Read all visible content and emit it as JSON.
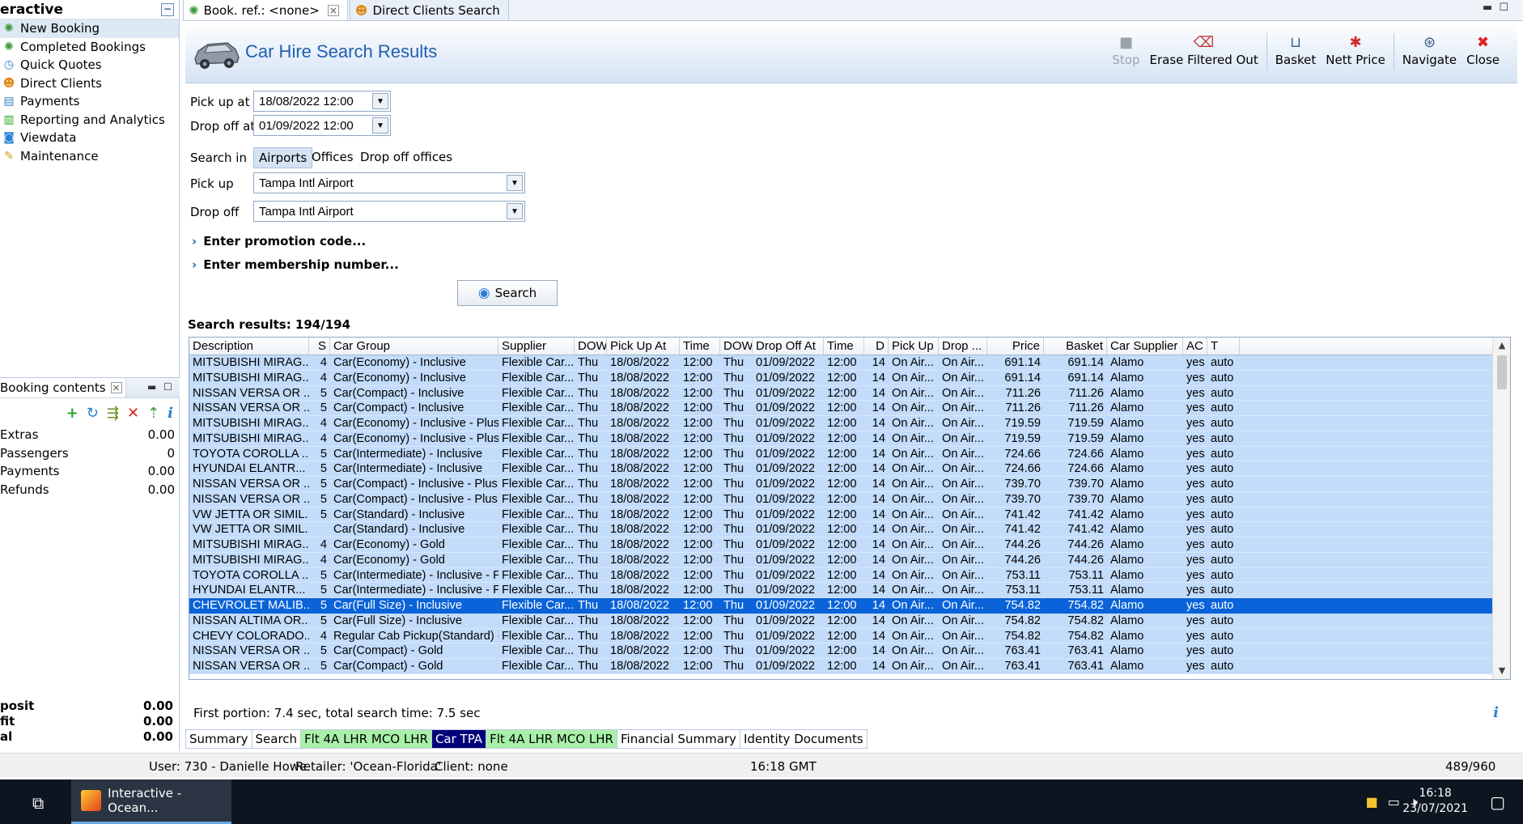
{
  "nav": {
    "title": "eractive",
    "items": [
      {
        "label": "New Booking",
        "icon": "palm-tree-icon",
        "selected": true
      },
      {
        "label": "Completed Bookings",
        "icon": "palm-tree-icon"
      },
      {
        "label": "Quick Quotes",
        "icon": "clock-icon"
      },
      {
        "label": "Direct Clients",
        "icon": "person-icon"
      },
      {
        "label": "Payments",
        "icon": "card-icon"
      },
      {
        "label": "Reporting and Analytics",
        "icon": "chart-icon"
      },
      {
        "label": "Viewdata",
        "icon": "monitor-icon"
      },
      {
        "label": "Maintenance",
        "icon": "tools-icon"
      }
    ]
  },
  "booking": {
    "title": "Booking contents",
    "rows": [
      {
        "label": "Extras",
        "value": "0.00"
      },
      {
        "label": "Passengers",
        "value": "0"
      },
      {
        "label": "Payments",
        "value": "0.00"
      },
      {
        "label": "Refunds",
        "value": "0.00"
      }
    ],
    "totals": [
      {
        "label": "posit",
        "value": "0.00"
      },
      {
        "label": "fit",
        "value": "0.00"
      },
      {
        "label": "al",
        "value": "0.00"
      }
    ]
  },
  "doc_tabs": [
    {
      "label": "Book. ref.: <none>",
      "closable": true,
      "active": true
    },
    {
      "label": "Direct Clients Search",
      "closable": false,
      "active": false
    }
  ],
  "header": {
    "title": "Car Hire Search Results",
    "toolbar": [
      {
        "label": "Stop",
        "icon": "stop-icon",
        "disabled": true
      },
      {
        "label": "Erase Filtered Out",
        "icon": "erase-icon"
      },
      {
        "sep": true
      },
      {
        "label": "Basket",
        "icon": "basket-icon"
      },
      {
        "label": "Nett Price",
        "icon": "nett-price-icon"
      },
      {
        "sep": true
      },
      {
        "label": "Navigate",
        "icon": "navigate-icon"
      },
      {
        "label": "Close",
        "icon": "close-icon"
      }
    ]
  },
  "form": {
    "pickup_at_label": "Pick up at",
    "pickup_at_value": "18/08/2022 12:00",
    "dropoff_at_label": "Drop off at",
    "dropoff_at_value": "01/09/2022 12:00",
    "search_in_label": "Search in",
    "search_in_options": [
      "Airports",
      "Offices",
      "Drop off offices"
    ],
    "pickup_label": "Pick up",
    "pickup_value": "Tampa Intl Airport",
    "dropoff_label": "Drop off",
    "dropoff_value": "Tampa Intl Airport",
    "promo": "Enter promotion code...",
    "membership": "Enter membership number...",
    "search_button": "Search",
    "results_label": "Search results: 194/194"
  },
  "grid": {
    "columns": [
      "Description",
      "S",
      "Car Group",
      "Supplier",
      "DOW",
      "Pick Up At",
      "Time",
      "DOW",
      "Drop Off At",
      "Time",
      "D",
      "Pick Up",
      "Drop ...",
      "Price",
      "Basket",
      "Car Supplier",
      "AC",
      "T"
    ],
    "rows": [
      [
        "MITSUBISHI MIRAG...",
        "4",
        "Car(Economy) - Inclusive",
        "Flexible Car...",
        "Thu",
        "18/08/2022",
        "12:00",
        "Thu",
        "01/09/2022",
        "12:00",
        "14",
        "On Air...",
        "On Air...",
        "691.14",
        "691.14",
        "Alamo",
        "yes",
        "auto"
      ],
      [
        "MITSUBISHI MIRAG...",
        "4",
        "Car(Economy) - Inclusive",
        "Flexible Car...",
        "Thu",
        "18/08/2022",
        "12:00",
        "Thu",
        "01/09/2022",
        "12:00",
        "14",
        "On Air...",
        "On Air...",
        "691.14",
        "691.14",
        "Alamo",
        "yes",
        "auto"
      ],
      [
        "NISSAN VERSA OR ...",
        "5",
        "Car(Compact) - Inclusive",
        "Flexible Car...",
        "Thu",
        "18/08/2022",
        "12:00",
        "Thu",
        "01/09/2022",
        "12:00",
        "14",
        "On Air...",
        "On Air...",
        "711.26",
        "711.26",
        "Alamo",
        "yes",
        "auto"
      ],
      [
        "NISSAN VERSA OR ...",
        "5",
        "Car(Compact) - Inclusive",
        "Flexible Car...",
        "Thu",
        "18/08/2022",
        "12:00",
        "Thu",
        "01/09/2022",
        "12:00",
        "14",
        "On Air...",
        "On Air...",
        "711.26",
        "711.26",
        "Alamo",
        "yes",
        "auto"
      ],
      [
        "MITSUBISHI MIRAG...",
        "4",
        "Car(Economy) - Inclusive - Plus Ex...",
        "Flexible Car...",
        "Thu",
        "18/08/2022",
        "12:00",
        "Thu",
        "01/09/2022",
        "12:00",
        "14",
        "On Air...",
        "On Air...",
        "719.59",
        "719.59",
        "Alamo",
        "yes",
        "auto"
      ],
      [
        "MITSUBISHI MIRAG...",
        "4",
        "Car(Economy) - Inclusive - Plus Ex...",
        "Flexible Car...",
        "Thu",
        "18/08/2022",
        "12:00",
        "Thu",
        "01/09/2022",
        "12:00",
        "14",
        "On Air...",
        "On Air...",
        "719.59",
        "719.59",
        "Alamo",
        "yes",
        "auto"
      ],
      [
        "TOYOTA COROLLA ...",
        "5",
        "Car(Intermediate) - Inclusive",
        "Flexible Car...",
        "Thu",
        "18/08/2022",
        "12:00",
        "Thu",
        "01/09/2022",
        "12:00",
        "14",
        "On Air...",
        "On Air...",
        "724.66",
        "724.66",
        "Alamo",
        "yes",
        "auto"
      ],
      [
        "HYUNDAI ELANTR...",
        "5",
        "Car(Intermediate) - Inclusive",
        "Flexible Car...",
        "Thu",
        "18/08/2022",
        "12:00",
        "Thu",
        "01/09/2022",
        "12:00",
        "14",
        "On Air...",
        "On Air...",
        "724.66",
        "724.66",
        "Alamo",
        "yes",
        "auto"
      ],
      [
        "NISSAN VERSA OR ...",
        "5",
        "Car(Compact) - Inclusive - Plus Exc...",
        "Flexible Car...",
        "Thu",
        "18/08/2022",
        "12:00",
        "Thu",
        "01/09/2022",
        "12:00",
        "14",
        "On Air...",
        "On Air...",
        "739.70",
        "739.70",
        "Alamo",
        "yes",
        "auto"
      ],
      [
        "NISSAN VERSA OR ...",
        "5",
        "Car(Compact) - Inclusive - Plus Exc...",
        "Flexible Car...",
        "Thu",
        "18/08/2022",
        "12:00",
        "Thu",
        "01/09/2022",
        "12:00",
        "14",
        "On Air...",
        "On Air...",
        "739.70",
        "739.70",
        "Alamo",
        "yes",
        "auto"
      ],
      [
        "VW JETTA OR SIMIL...",
        "5",
        "Car(Standard) - Inclusive",
        "Flexible Car...",
        "Thu",
        "18/08/2022",
        "12:00",
        "Thu",
        "01/09/2022",
        "12:00",
        "14",
        "On Air...",
        "On Air...",
        "741.42",
        "741.42",
        "Alamo",
        "yes",
        "auto"
      ],
      [
        "VW JETTA OR SIMIL...",
        "",
        "Car(Standard) - Inclusive",
        "Flexible Car...",
        "Thu",
        "18/08/2022",
        "12:00",
        "Thu",
        "01/09/2022",
        "12:00",
        "14",
        "On Air...",
        "On Air...",
        "741.42",
        "741.42",
        "Alamo",
        "yes",
        "auto"
      ],
      [
        "MITSUBISHI MIRAG...",
        "4",
        "Car(Economy) - Gold",
        "Flexible Car...",
        "Thu",
        "18/08/2022",
        "12:00",
        "Thu",
        "01/09/2022",
        "12:00",
        "14",
        "On Air...",
        "On Air...",
        "744.26",
        "744.26",
        "Alamo",
        "yes",
        "auto"
      ],
      [
        "MITSUBISHI MIRAG...",
        "4",
        "Car(Economy) - Gold",
        "Flexible Car...",
        "Thu",
        "18/08/2022",
        "12:00",
        "Thu",
        "01/09/2022",
        "12:00",
        "14",
        "On Air...",
        "On Air...",
        "744.26",
        "744.26",
        "Alamo",
        "yes",
        "auto"
      ],
      [
        "TOYOTA COROLLA ...",
        "5",
        "Car(Intermediate) - Inclusive - Plus...",
        "Flexible Car...",
        "Thu",
        "18/08/2022",
        "12:00",
        "Thu",
        "01/09/2022",
        "12:00",
        "14",
        "On Air...",
        "On Air...",
        "753.11",
        "753.11",
        "Alamo",
        "yes",
        "auto"
      ],
      [
        "HYUNDAI ELANTR...",
        "5",
        "Car(Intermediate) - Inclusive - Plus...",
        "Flexible Car...",
        "Thu",
        "18/08/2022",
        "12:00",
        "Thu",
        "01/09/2022",
        "12:00",
        "14",
        "On Air...",
        "On Air...",
        "753.11",
        "753.11",
        "Alamo",
        "yes",
        "auto"
      ],
      [
        "CHEVROLET MALIB...",
        "5",
        "Car(Full Size) - Inclusive",
        "Flexible Car...",
        "Thu",
        "18/08/2022",
        "12:00",
        "Thu",
        "01/09/2022",
        "12:00",
        "14",
        "On Air...",
        "On Air...",
        "754.82",
        "754.82",
        "Alamo",
        "yes",
        "auto"
      ],
      [
        "NISSAN ALTIMA OR...",
        "5",
        "Car(Full Size) - Inclusive",
        "Flexible Car...",
        "Thu",
        "18/08/2022",
        "12:00",
        "Thu",
        "01/09/2022",
        "12:00",
        "14",
        "On Air...",
        "On Air...",
        "754.82",
        "754.82",
        "Alamo",
        "yes",
        "auto"
      ],
      [
        "CHEVY COLORADO...",
        "4",
        "Regular Cab Pickup(Standard) - Inc...",
        "Flexible Car...",
        "Thu",
        "18/08/2022",
        "12:00",
        "Thu",
        "01/09/2022",
        "12:00",
        "14",
        "On Air...",
        "On Air...",
        "754.82",
        "754.82",
        "Alamo",
        "yes",
        "auto"
      ],
      [
        "NISSAN VERSA OR ...",
        "5",
        "Car(Compact) - Gold",
        "Flexible Car...",
        "Thu",
        "18/08/2022",
        "12:00",
        "Thu",
        "01/09/2022",
        "12:00",
        "14",
        "On Air...",
        "On Air...",
        "763.41",
        "763.41",
        "Alamo",
        "yes",
        "auto"
      ],
      [
        "NISSAN VERSA OR ...",
        "5",
        "Car(Compact) - Gold",
        "Flexible Car...",
        "Thu",
        "18/08/2022",
        "12:00",
        "Thu",
        "01/09/2022",
        "12:00",
        "14",
        "On Air...",
        "On Air...",
        "763.41",
        "763.41",
        "Alamo",
        "yes",
        "auto"
      ]
    ],
    "selected_row": 16
  },
  "timing": "First portion: 7.4 sec, total search time: 7.5 sec",
  "bottom_tabs": [
    {
      "label": "Summary",
      "style": "plain"
    },
    {
      "label": "Search",
      "style": "plain"
    },
    {
      "label": "Flt 4A LHR MCO LHR",
      "style": "green"
    },
    {
      "label": "Car TPA",
      "style": "navy"
    },
    {
      "label": "Flt 4A LHR MCO LHR",
      "style": "green"
    },
    {
      "label": "Financial Summary",
      "style": "plain"
    },
    {
      "label": "Identity Documents",
      "style": "plain"
    }
  ],
  "status": {
    "user": "User: 730 - Danielle Howe",
    "retailer": "Retailer: 'Ocean-Florida'",
    "client": "Client: none",
    "time": "16:18 GMT",
    "memory": "489/960"
  },
  "taskbar": {
    "app_label": "Interactive - Ocean...",
    "clock_time": "16:18",
    "clock_date": "23/07/2021"
  },
  "colors": {
    "row_bg": "#c2dcfa",
    "row_selected_bg": "#0a63d8",
    "title_blue": "#1f5fb0",
    "tab_green": "#a8f0a8",
    "tab_navy": "#00007a"
  }
}
